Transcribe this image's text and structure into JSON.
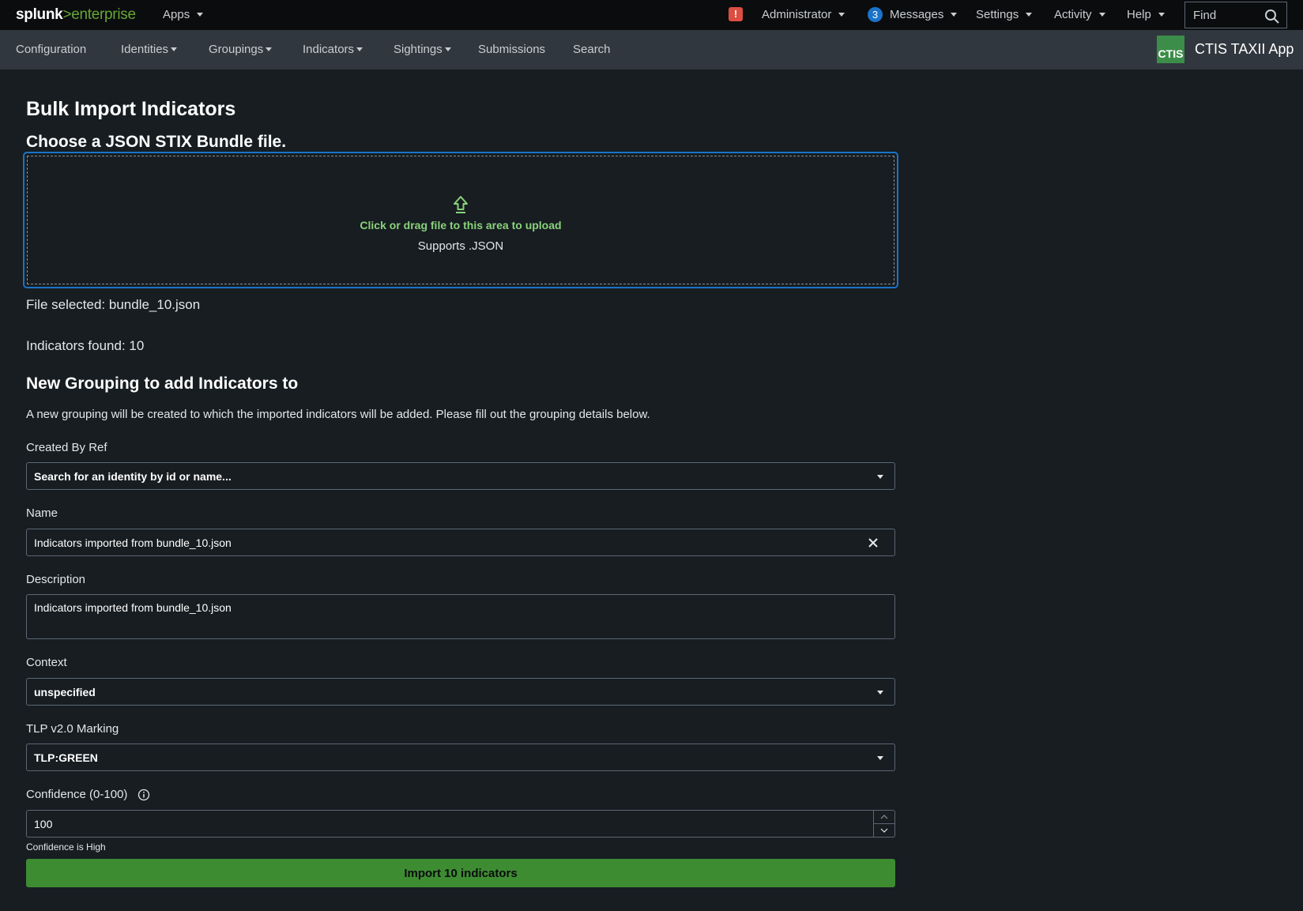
{
  "topbar": {
    "logo_splunk": "splunk",
    "logo_gt": ">",
    "logo_product": "enterprise",
    "apps": "Apps",
    "alert_glyph": "!",
    "administrator": "Administrator",
    "messages_count": "3",
    "messages": "Messages",
    "settings": "Settings",
    "activity": "Activity",
    "help": "Help",
    "find_placeholder": "Find"
  },
  "appbar": {
    "nav": [
      "Configuration",
      "Identities",
      "Groupings",
      "Indicators",
      "Sightings",
      "Submissions",
      "Search"
    ],
    "app_logo_text": "CTIS",
    "app_title": "CTIS TAXII App"
  },
  "main": {
    "title": "Bulk Import Indicators",
    "choose_file": "Choose a JSON STIX Bundle file.",
    "dropzone_text": "Click or drag file to this area to upload",
    "dropzone_sub": "Supports .JSON",
    "file_selected": "File selected: bundle_10.json",
    "indicators_found": "Indicators found: 10",
    "grouping_heading": "New Grouping to add Indicators to",
    "grouping_desc": "A new grouping will be created to which the imported indicators will be added. Please fill out the grouping details below.",
    "created_by_label": "Created By Ref",
    "created_by_placeholder": "Search for an identity by id or name...",
    "name_label": "Name",
    "name_value": "Indicators imported from bundle_10.json",
    "description_label": "Description",
    "description_value": "Indicators imported from bundle_10.json",
    "context_label": "Context",
    "context_value": "unspecified",
    "tlp_label": "TLP v2.0 Marking",
    "tlp_value": "TLP:GREEN",
    "confidence_label": "Confidence (0-100)",
    "confidence_value": "100",
    "confidence_hint": "Confidence is High",
    "import_button": "Import 10 indicators"
  },
  "colors": {
    "accent_blue": "#1a73c9",
    "success_green": "#3e8c32",
    "upload_text_green": "#8ad27b",
    "alert_red": "#dc4e41"
  },
  "icons": [
    "alert-icon",
    "search-icon",
    "upload-icon",
    "clear-icon",
    "info-icon",
    "chevron-up-icon",
    "chevron-down-icon"
  ]
}
